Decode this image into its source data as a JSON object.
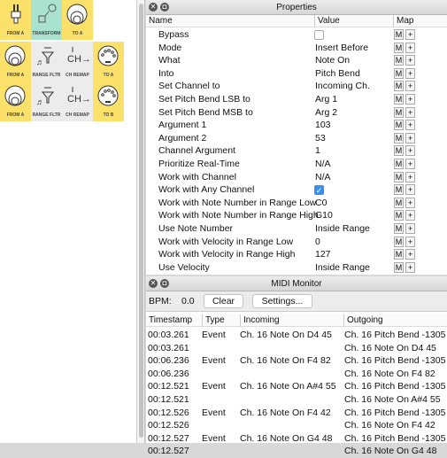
{
  "patch": {
    "tiles": [
      {
        "label": "FROM A",
        "icon": "rca-plug-icon",
        "color": "#fbe06a"
      },
      {
        "label": "TRANSFORM",
        "icon": "transform-icon",
        "color": "#a9e2cf"
      },
      {
        "label": "TO A",
        "icon": "speaker-icon",
        "color": "#fbe06a"
      },
      {
        "label": "FROM A",
        "icon": "speaker-icon",
        "color": "#fbe06a"
      },
      {
        "label": "RANGE FLTR",
        "icon": "range-filter-icon",
        "color": "#ececec"
      },
      {
        "label": "CH REMAP",
        "icon": "channel-remap-icon",
        "color": "#ececec"
      },
      {
        "label": "TO A",
        "icon": "midi-din-icon",
        "color": "#fbe06a"
      },
      {
        "label": "FROM A",
        "icon": "speaker-icon",
        "color": "#fbe06a"
      },
      {
        "label": "RANGE FLTR",
        "icon": "range-filter-icon",
        "color": "#ececec"
      },
      {
        "label": "CH REMAP",
        "icon": "channel-remap-icon",
        "color": "#ececec"
      },
      {
        "label": "TO B",
        "icon": "midi-din-icon",
        "color": "#fbe06a"
      }
    ]
  },
  "properties": {
    "title": "Properties",
    "columns": [
      "Name",
      "Value",
      "Map"
    ],
    "map_m": "M",
    "map_plus": "+",
    "rows": [
      {
        "name": "Bypass",
        "value": "",
        "checkbox": false
      },
      {
        "name": "Mode",
        "value": "Insert Before"
      },
      {
        "name": "What",
        "value": "Note On"
      },
      {
        "name": "Into",
        "value": "Pitch Bend"
      },
      {
        "name": "Set Channel to",
        "value": "Incoming Ch."
      },
      {
        "name": "Set Pitch Bend LSB to",
        "value": "Arg 1"
      },
      {
        "name": "Set Pitch Bend MSB to",
        "value": "Arg 2"
      },
      {
        "name": "Argument 1",
        "value": "103"
      },
      {
        "name": "Argument 2",
        "value": "53"
      },
      {
        "name": "Channel Argument",
        "value": "1"
      },
      {
        "name": "Prioritize Real-Time",
        "value": "N/A"
      },
      {
        "name": "Work with Channel",
        "value": "N/A"
      },
      {
        "name": "Work with Any Channel",
        "value": "",
        "checkbox": true
      },
      {
        "name": "Work with Note Number in Range Low",
        "value": "C0"
      },
      {
        "name": "Work with Note Number in Range High",
        "value": "G10"
      },
      {
        "name": "Use Note Number",
        "value": "Inside Range"
      },
      {
        "name": "Work with Velocity in Range Low",
        "value": "0"
      },
      {
        "name": "Work with Velocity in Range High",
        "value": "127"
      },
      {
        "name": "Use Velocity",
        "value": "Inside Range"
      }
    ]
  },
  "monitor": {
    "title": "MIDI Monitor",
    "bpm_label": "BPM:",
    "bpm_value": "0.0",
    "clear": "Clear",
    "settings": "Settings...",
    "columns": [
      "Timestamp",
      "Type",
      "Incoming",
      "Outgoing"
    ],
    "rows": [
      [
        "00:03.261",
        "Event",
        "Ch. 16 Note On D4 45",
        "Ch. 16 Pitch Bend -1305"
      ],
      [
        "00:03.261",
        "",
        "",
        "Ch. 16 Note On D4 45"
      ],
      [
        "00:06.236",
        "Event",
        "Ch. 16 Note On F4 82",
        "Ch. 16 Pitch Bend -1305"
      ],
      [
        "00:06.236",
        "",
        "",
        "Ch. 16 Note On F4 82"
      ],
      [
        "00:12.521",
        "Event",
        "Ch. 16 Note On A#4 55",
        "Ch. 16 Pitch Bend -1305"
      ],
      [
        "00:12.521",
        "",
        "",
        "Ch. 16 Note On A#4 55"
      ],
      [
        "00:12.526",
        "Event",
        "Ch. 16 Note On F4 42",
        "Ch. 16 Pitch Bend -1305"
      ],
      [
        "00:12.526",
        "",
        "",
        "Ch. 16 Note On F4 42"
      ],
      [
        "00:12.527",
        "Event",
        "Ch. 16 Note On G4 48",
        "Ch. 16 Pitch Bend -1305"
      ],
      [
        "00:12.527",
        "",
        "",
        "Ch. 16 Note On G4 48"
      ]
    ]
  }
}
